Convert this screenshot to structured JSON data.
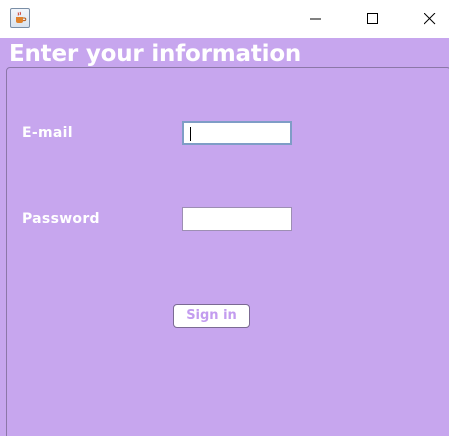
{
  "window": {
    "title": "",
    "controls": [
      "minimize-icon",
      "maximize-icon",
      "close-icon"
    ]
  },
  "header": {
    "title": "Enter your information"
  },
  "form": {
    "email_label": "E-mail",
    "email_value": "",
    "password_label": "Password",
    "password_value": "",
    "submit_label": "Sign in"
  },
  "colors": {
    "background": "#c7a6ee",
    "title_text": "#ffffff",
    "button_text": "#c39cef",
    "focus_border": "#7f9dc6"
  }
}
